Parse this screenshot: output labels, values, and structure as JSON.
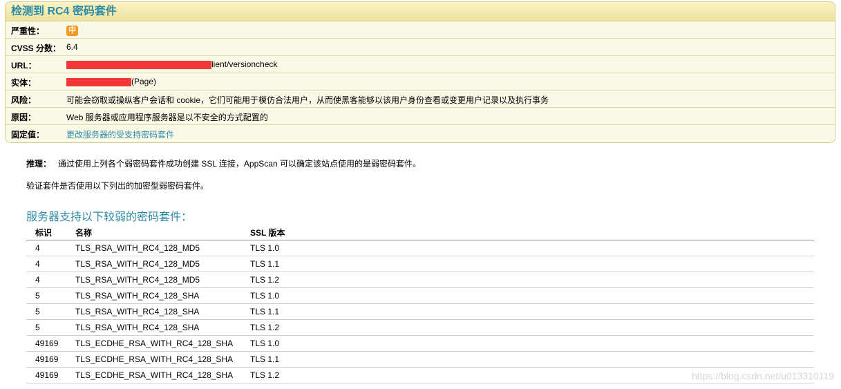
{
  "panel": {
    "title": "检测到 RC4 密码套件",
    "rows": {
      "severity": {
        "label": "严重性：",
        "badge": "中",
        "badge_color": "#f39a1e"
      },
      "cvss": {
        "label": "CVSS 分数：",
        "value": "6.4"
      },
      "url": {
        "label": "URL：",
        "value": "lient/versioncheck"
      },
      "entity": {
        "label": "实体：",
        "value": "(Page)"
      },
      "risk": {
        "label": "风险：",
        "value": "可能会窃取或操纵客户会话和 cookie，它们可能用于模仿合法用户，从而使黑客能够以该用户身份查看或变更用户记录以及执行事务"
      },
      "cause": {
        "label": "原因：",
        "value": "Web 服务器或应用程序服务器是以不安全的方式配置的"
      },
      "fix": {
        "label": "固定值：",
        "value": "更改服务器的受支持密码套件"
      }
    }
  },
  "reasoning": {
    "label": "推理：",
    "text": "通过使用上列各个弱密码套件成功创建 SSL 连接，AppScan 可以确定该站点使用的是弱密码套件。",
    "verify": "验证套件是否使用以下列出的加密型弱密码套件。"
  },
  "ciphers": {
    "title": "服务器支持以下较弱的密码套件：",
    "headers": [
      "标识",
      "名称",
      "SSL 版本"
    ],
    "rows": [
      [
        "4",
        "TLS_RSA_WITH_RC4_128_MD5",
        "TLS 1.0"
      ],
      [
        "4",
        "TLS_RSA_WITH_RC4_128_MD5",
        "TLS 1.1"
      ],
      [
        "4",
        "TLS_RSA_WITH_RC4_128_MD5",
        "TLS 1.2"
      ],
      [
        "5",
        "TLS_RSA_WITH_RC4_128_SHA",
        "TLS 1.0"
      ],
      [
        "5",
        "TLS_RSA_WITH_RC4_128_SHA",
        "TLS 1.1"
      ],
      [
        "5",
        "TLS_RSA_WITH_RC4_128_SHA",
        "TLS 1.2"
      ],
      [
        "49169",
        "TLS_ECDHE_RSA_WITH_RC4_128_SHA",
        "TLS 1.0"
      ],
      [
        "49169",
        "TLS_ECDHE_RSA_WITH_RC4_128_SHA",
        "TLS 1.1"
      ],
      [
        "49169",
        "TLS_ECDHE_RSA_WITH_RC4_128_SHA",
        "TLS 1.2"
      ]
    ]
  },
  "watermark": "https://blog.csdn.net/u013310119"
}
